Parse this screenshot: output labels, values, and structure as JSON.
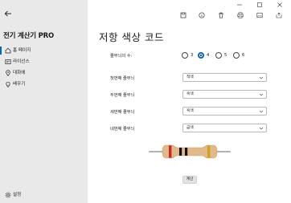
{
  "app": {
    "title": "전기 계산기 PRO"
  },
  "sidebar": {
    "items": [
      {
        "label": "홈 페이지",
        "icon": "home-icon",
        "selected": true
      },
      {
        "label": "라이선스",
        "icon": "license-icon",
        "selected": false
      },
      {
        "label": "대화에",
        "icon": "location-pin-icon",
        "selected": false
      },
      {
        "label": "배우기",
        "icon": "bulb-icon",
        "selected": false
      }
    ],
    "settings_label": "설정"
  },
  "toolbar": {
    "icons": [
      "save-icon",
      "info-icon",
      "delete-icon",
      "print-icon",
      "image-icon",
      "share-icon"
    ]
  },
  "window_controls": {
    "icons": [
      "minimize-icon",
      "maximize-icon",
      "close-icon"
    ]
  },
  "page": {
    "title": "저항 색상 코드",
    "band_count_label": "줄무늬의 수:",
    "band_options": [
      "3",
      "4",
      "5",
      "6"
    ],
    "band_selected": "4",
    "bands": [
      {
        "label": "첫번째 줄무늬",
        "value": "적색"
      },
      {
        "label": "두번째 줄무늬",
        "value": "흑색"
      },
      {
        "label": "세번째 줄무늬",
        "value": "흑색"
      },
      {
        "label": "네번째 줄무늬",
        "value": "금색"
      }
    ],
    "calculate_label": "계산"
  },
  "colors": {
    "accent": "#0067c0",
    "sidebar_bg": "#e9e9e9",
    "resistor_body": "#e2b98a",
    "band_colors": [
      "#c62828",
      "#111111",
      "#111111",
      "#c9a227"
    ]
  }
}
